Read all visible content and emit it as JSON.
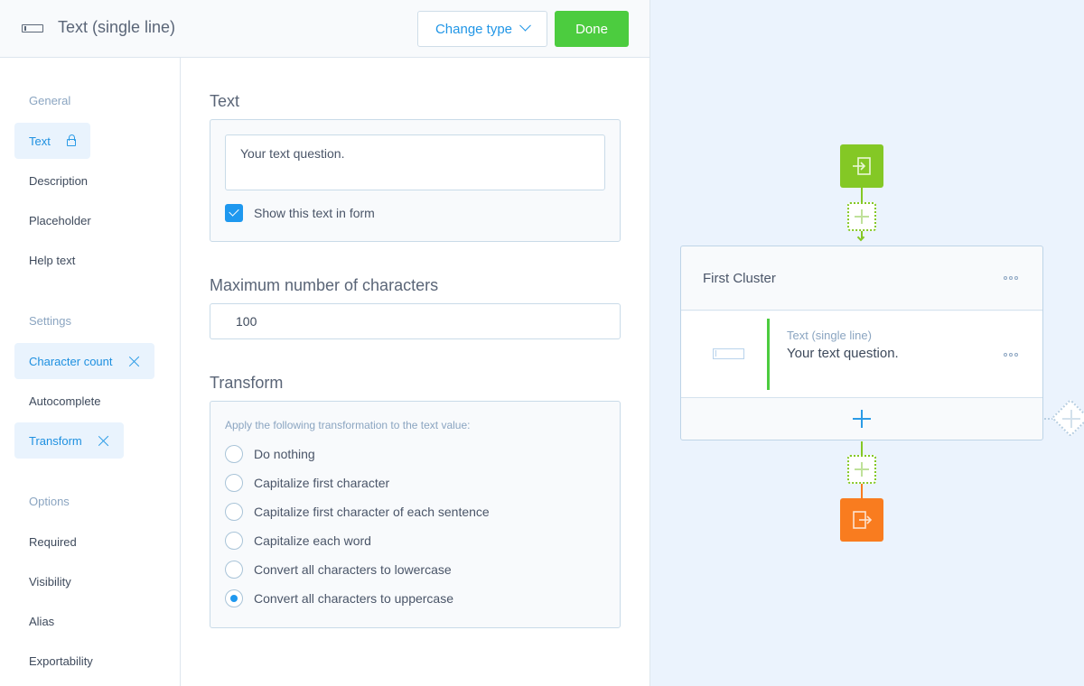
{
  "header": {
    "field_type_icon": "text-input-icon",
    "title": "Text (single line)",
    "change_type_label": "Change type",
    "done_label": "Done"
  },
  "sidebar": {
    "groups": [
      {
        "label": "General",
        "items": [
          {
            "label": "Text",
            "active": true,
            "icon": "lock-icon"
          },
          {
            "label": "Description",
            "active": false
          },
          {
            "label": "Placeholder",
            "active": false
          },
          {
            "label": "Help text",
            "active": false
          }
        ]
      },
      {
        "label": "Settings",
        "items": [
          {
            "label": "Character count",
            "active": true,
            "icon": "remove-icon"
          },
          {
            "label": "Autocomplete",
            "active": false
          },
          {
            "label": "Transform",
            "active": true,
            "icon": "remove-icon"
          }
        ]
      },
      {
        "label": "Options",
        "items": [
          {
            "label": "Required",
            "active": false
          },
          {
            "label": "Visibility",
            "active": false
          },
          {
            "label": "Alias",
            "active": false
          },
          {
            "label": "Exportability",
            "active": false
          }
        ]
      }
    ]
  },
  "main": {
    "text_section": {
      "title": "Text",
      "value": "Your text question.",
      "show_in_form_label": "Show this text in form",
      "show_in_form_checked": true
    },
    "max_chars_section": {
      "title": "Maximum number of characters",
      "value": "100"
    },
    "transform_section": {
      "title": "Transform",
      "hint": "Apply the following transformation to the text value:",
      "options": [
        {
          "label": "Do nothing",
          "selected": false
        },
        {
          "label": "Capitalize first character",
          "selected": false
        },
        {
          "label": "Capitalize first character of each sentence",
          "selected": false
        },
        {
          "label": "Capitalize each word",
          "selected": false
        },
        {
          "label": "Convert all characters to lowercase",
          "selected": false
        },
        {
          "label": "Convert all characters to uppercase",
          "selected": true
        }
      ]
    }
  },
  "canvas": {
    "start_icon": "enter-icon",
    "end_icon": "exit-icon",
    "cluster": {
      "title": "First Cluster",
      "question": {
        "type": "Text (single line)",
        "text": "Your text question."
      }
    },
    "colors": {
      "start": "#84c825",
      "end": "#f97c1f",
      "accent": "#1e98ef",
      "done": "#4ccc3f",
      "canvas_bg": "#ebf3fd"
    }
  }
}
